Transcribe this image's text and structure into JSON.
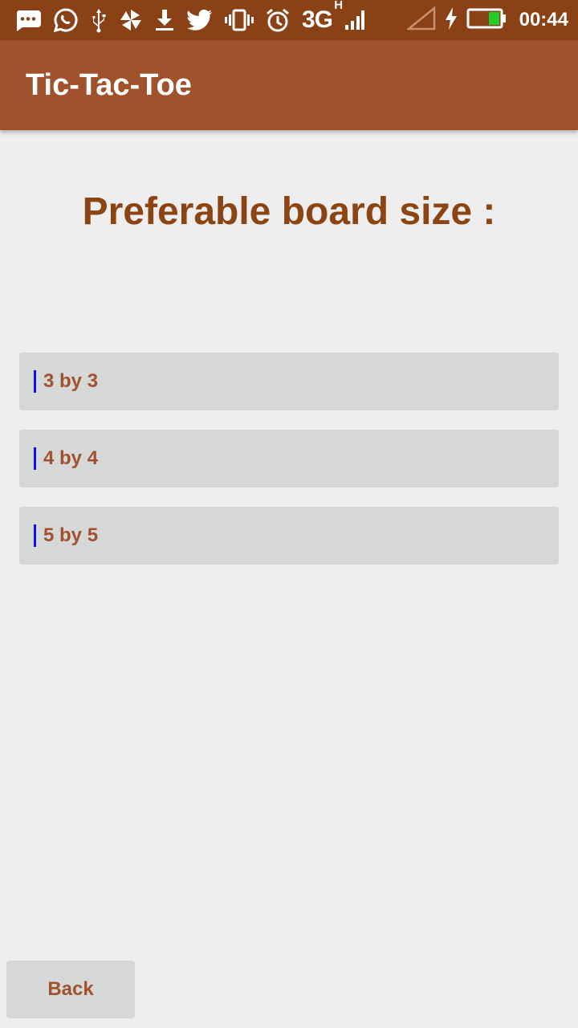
{
  "status_bar": {
    "network": "3G",
    "network_sub": "H",
    "time": "00:44",
    "icons": [
      "message-icon",
      "whatsapp-icon",
      "usb-icon",
      "pinwheel-icon",
      "download-icon",
      "twitter-icon",
      "vibrate-icon",
      "alarm-icon",
      "signal-icon",
      "no-signal-icon",
      "charging-icon",
      "battery-icon"
    ],
    "battery_level": 0.35,
    "battery_color": "#22cc22"
  },
  "app_bar": {
    "title": "Tic-Tac-Toe",
    "color": "#a0522d"
  },
  "main": {
    "heading": "Preferable board size :",
    "options": [
      {
        "label": "3 by 3"
      },
      {
        "label": "4 by 4"
      },
      {
        "label": "5 by 5"
      }
    ]
  },
  "footer": {
    "back_label": "Back"
  },
  "colors": {
    "status_bar": "#8a4115",
    "accent_text": "#a0522d",
    "heading": "#8b4513",
    "button_bg": "#d6d7d7",
    "background": "#eeeeee"
  }
}
